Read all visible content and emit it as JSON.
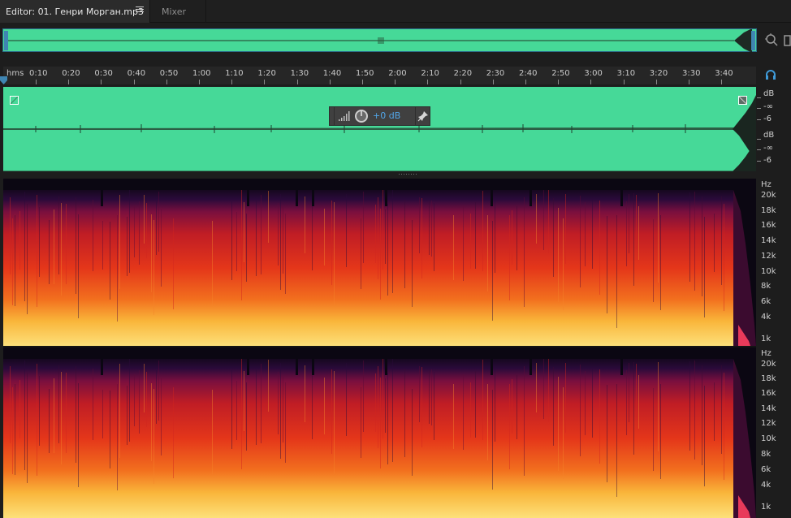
{
  "tabs": {
    "editor_label": "Editor: 01. Генри Морган.mp3",
    "mixer_label": "Mixer"
  },
  "ruler": {
    "unit_label": "hms",
    "ticks": [
      "0:10",
      "0:20",
      "0:30",
      "0:40",
      "0:50",
      "1:00",
      "1:10",
      "1:20",
      "1:30",
      "1:40",
      "1:50",
      "2:00",
      "2:10",
      "2:20",
      "2:30",
      "2:40",
      "2:50",
      "3:00",
      "3:10",
      "3:20",
      "3:30",
      "3:40"
    ]
  },
  "hud": {
    "volume_value": "+0 dB"
  },
  "db_scale": {
    "labels": [
      "dB",
      "-∞",
      "-6",
      "dB",
      "-∞",
      "-6"
    ]
  },
  "hz_scale": {
    "labels": [
      "Hz",
      "20k",
      "18k",
      "16k",
      "14k",
      "12k",
      "10k",
      "8k",
      "6k",
      "4k",
      "1k"
    ]
  },
  "colors": {
    "waveform": "#46d998",
    "accent": "#3f85b2",
    "background": "#1d1d1d"
  },
  "icons": [
    "menu-icon",
    "zoom-icon",
    "headphones-icon",
    "volume-icon",
    "knob-icon",
    "pin-icon",
    "playhead-icon"
  ]
}
